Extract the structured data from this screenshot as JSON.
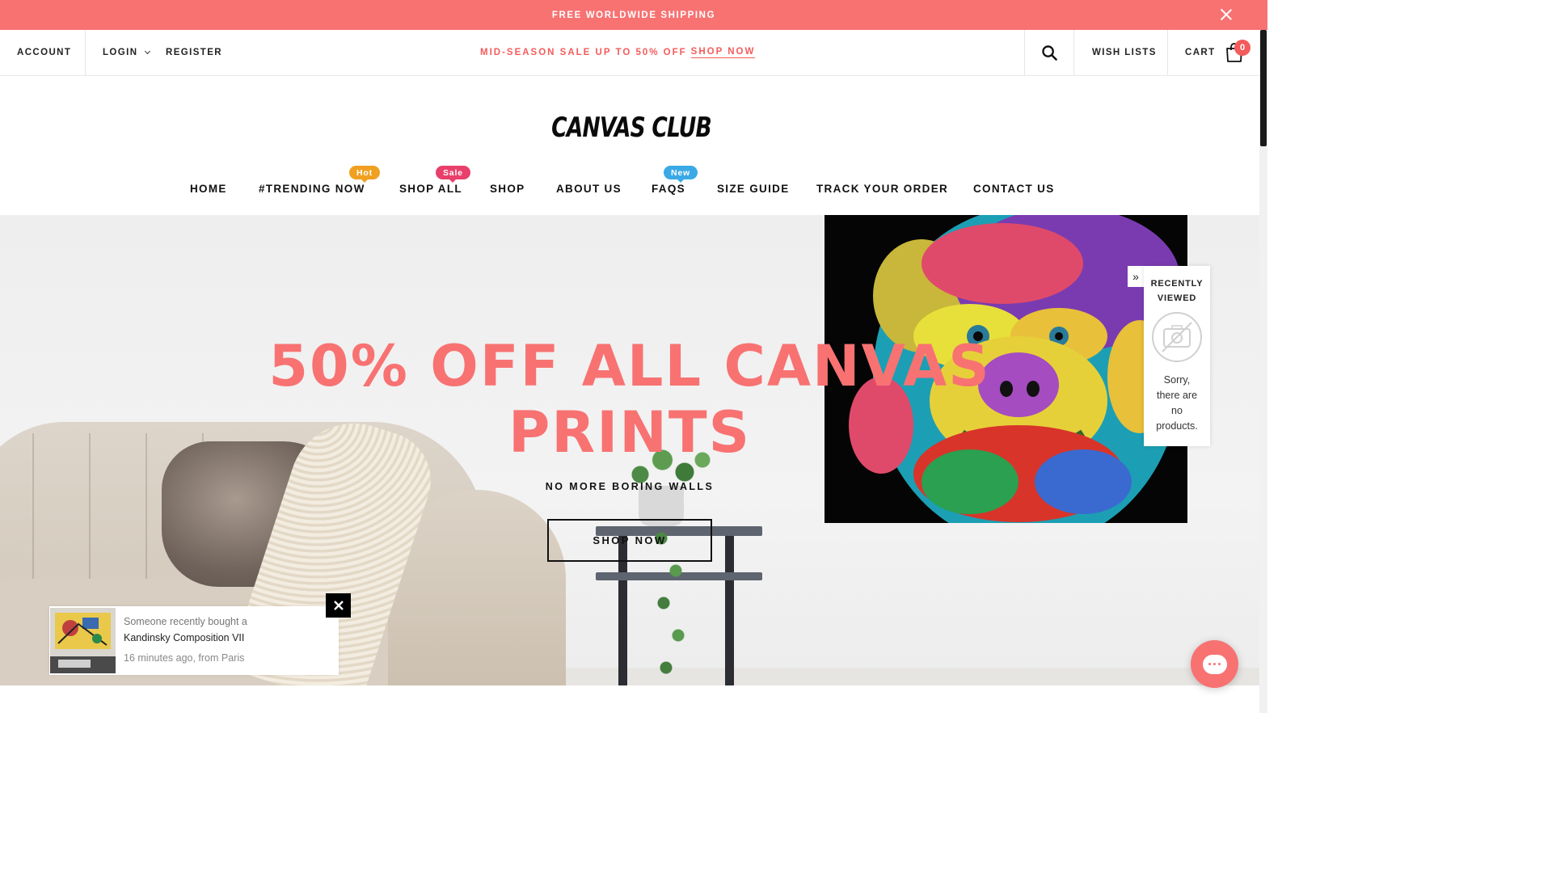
{
  "announcement": {
    "text": "FREE WORLDWIDE SHIPPING",
    "close_icon": "close-icon"
  },
  "topbar": {
    "account": "ACCOUNT",
    "login": "LOGIN",
    "register": "REGISTER",
    "promo_text": "MID-SEASON SALE UP TO 50% OFF",
    "promo_link": "SHOP NOW",
    "search_icon": "search-icon",
    "wishlist": "WISH LISTS",
    "cart": "CART",
    "cart_count": "0"
  },
  "logo": {
    "text": "CANVAS CLUB"
  },
  "nav": {
    "items": [
      {
        "label": "HOME"
      },
      {
        "label": "#TRENDING NOW",
        "badge": "Hot"
      },
      {
        "label": "SHOP ALL",
        "badge": "Sale"
      },
      {
        "label": "SHOP"
      },
      {
        "label": "ABOUT US"
      },
      {
        "label": "FAQS",
        "badge": "New"
      },
      {
        "label": "SIZE GUIDE"
      },
      {
        "label": "TRACK YOUR ORDER"
      },
      {
        "label": "CONTACT US"
      }
    ]
  },
  "hero": {
    "title_line1": "50% OFF ALL CANVAS",
    "title_line2": "PRINTS",
    "subtitle": "NO MORE BORING WALLS",
    "button": "SHOP NOW"
  },
  "recently_viewed": {
    "title_line1": "RECENTLY",
    "title_line2": "VIEWED",
    "empty_lines": [
      "Sorry,",
      "there are",
      "no",
      "products."
    ]
  },
  "purchase_popup": {
    "line1": "Someone recently bought a",
    "product": "Kandinsky Composition VII",
    "meta": "16 minutes ago, from Paris"
  },
  "colors": {
    "accent": "#f87272",
    "promo": "#f45b5b",
    "badge_hot": "#f0a020",
    "badge_sale": "#e8406a",
    "badge_new": "#3aa9e6"
  }
}
